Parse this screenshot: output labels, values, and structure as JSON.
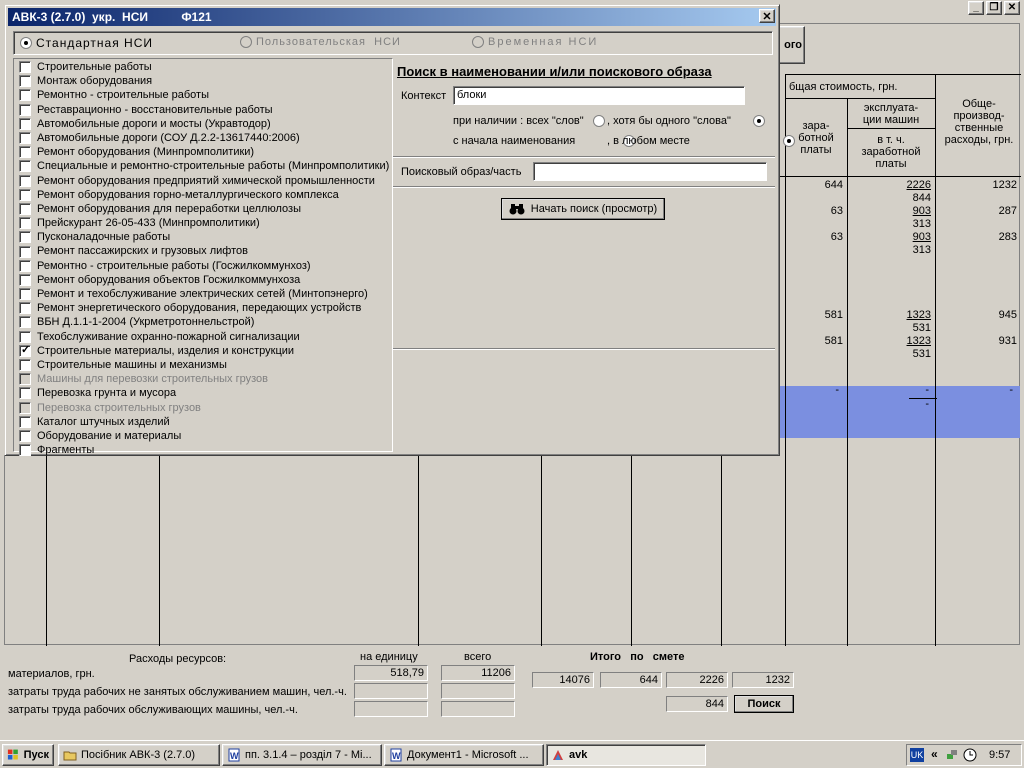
{
  "window_controls": [
    "_",
    "❐",
    "✕"
  ],
  "partial_button": "ого",
  "table": {
    "header_total": "бщая стоимость, грн.",
    "col_wage": "зара-\nботной\nплаты",
    "col_machine": "эксплуата-\nции машин",
    "col_machine_sub": "в т. ч.\nзаработной\nплаты",
    "col_overhead": "Обще-\nпроизвод-\nственные\nрасходы, грн.",
    "rows": [
      {
        "wage": "644",
        "machine": "2226",
        "machine_sub": "844",
        "overhead": "1232"
      },
      {
        "wage": "63",
        "machine": "903",
        "machine_sub": "313",
        "overhead": "287"
      },
      {
        "wage": "63",
        "machine": "903",
        "machine_sub": "313",
        "overhead": "283"
      },
      {
        "wage": "581",
        "machine": "1323",
        "machine_sub": "531",
        "overhead": "945"
      },
      {
        "wage": "581",
        "machine": "1323",
        "machine_sub": "531",
        "overhead": "931"
      }
    ],
    "selected_row": {
      "wage": "-",
      "machine": "-",
      "machine_sub": "-",
      "overhead": "-"
    }
  },
  "dialog": {
    "title": "АВК-3 (2.7.0)  укр.  НСИ          Ф121",
    "close": "✕",
    "nsi_options": [
      "Стандартная НСИ",
      "Пользовательская  НСИ",
      "Временная НСИ"
    ],
    "list": [
      {
        "label": "Строительные работы",
        "checked": false,
        "disabled": false
      },
      {
        "label": "Монтаж оборудования",
        "checked": false,
        "disabled": false
      },
      {
        "label": "Ремонтно - строительные работы",
        "checked": false,
        "disabled": false
      },
      {
        "label": "Реставрационно - восстановительные работы",
        "checked": false,
        "disabled": false
      },
      {
        "label": "Автомобильные дороги и мосты (Укравтодор)",
        "checked": false,
        "disabled": false
      },
      {
        "label": "Автомобильные дороги (СОУ Д.2.2-13617440:2006)",
        "checked": false,
        "disabled": false
      },
      {
        "label": "Ремонт оборудования (Минпромполитики)",
        "checked": false,
        "disabled": false
      },
      {
        "label": "Специальные и ремонтно-строительные работы (Минпромполитики)",
        "checked": false,
        "disabled": false
      },
      {
        "label": "Ремонт оборудования предприятий химической промышленности",
        "checked": false,
        "disabled": false
      },
      {
        "label": "Ремонт оборудования  горно-металлургического комплекса",
        "checked": false,
        "disabled": false
      },
      {
        "label": "Ремонт оборудования для переработки целлюлозы",
        "checked": false,
        "disabled": false
      },
      {
        "label": "Прейскурант 26-05-433 (Минпромполитики)",
        "checked": false,
        "disabled": false
      },
      {
        "label": "Пусконаладочные работы",
        "checked": false,
        "disabled": false
      },
      {
        "label": "Ремонт пассажирских и грузовых лифтов",
        "checked": false,
        "disabled": false
      },
      {
        "label": "Ремонтно - строительные работы (Госжилкоммунхоз)",
        "checked": false,
        "disabled": false
      },
      {
        "label": "Ремонт оборудования объектов Госжилкоммунхоза",
        "checked": false,
        "disabled": false
      },
      {
        "label": "Ремонт и техобслуживание электрических сетей (Минтопэнерго)",
        "checked": false,
        "disabled": false
      },
      {
        "label": "Ремонт энергетического оборудования, передающих устройств",
        "checked": false,
        "disabled": false
      },
      {
        "label": "ВБН Д.1.1-1-2004 (Укрметротоннельстрой)",
        "checked": false,
        "disabled": false
      },
      {
        "label": "Техобслуживание охранно-пожарной сигнализации",
        "checked": false,
        "disabled": false
      },
      {
        "label": "Строительные материалы, изделия и конструкции",
        "checked": true,
        "disabled": false
      },
      {
        "label": "Строительные машины и механизмы",
        "checked": false,
        "disabled": false
      },
      {
        "label": "Машины для перевозки строительных грузов",
        "checked": false,
        "disabled": true
      },
      {
        "label": "Перевозка грунта и мусора",
        "checked": false,
        "disabled": false
      },
      {
        "label": "Перевозка строительных грузов",
        "checked": false,
        "disabled": true
      },
      {
        "label": "Каталог штучных изделий",
        "checked": false,
        "disabled": false
      },
      {
        "label": "Оборудование и материалы",
        "checked": false,
        "disabled": false
      },
      {
        "label": "Фрагменты",
        "checked": false,
        "disabled": false
      }
    ],
    "search_title": "Поиск в наименовании и/или поискового образа",
    "context_label": "Контекст",
    "context_value": "блоки",
    "presence_label": "при наличии : всех \"слов\"",
    "presence_alt": ", хотя бы одного \"слова\"",
    "start_label": "с начала наименования",
    "start_alt": ", в любом месте",
    "pattern_label": "Поисковый образ/часть",
    "pattern_value": "",
    "search_button": "Начать поиск (просмотр)"
  },
  "bottom": {
    "resources_title": "Расходы ресурсов:",
    "per_unit": "на единицу",
    "total": "всего",
    "summary_title": "Итого   по   смете",
    "materials_label": "материалов, грн.",
    "materials_unit": "518,79",
    "materials_total": "11206",
    "labor1_label": "затраты труда рабочих не занятых обслуживанием машин, чел.-ч.",
    "labor2_label": "затраты труда рабочих обслуживающих машины, чел.-ч.",
    "sum1": "14076",
    "sum2": "644",
    "sum3": "2226",
    "sum4": "1232",
    "sum5": "844",
    "search_button": "Поиск"
  },
  "taskbar": {
    "start": "Пуск",
    "tasks": [
      "Посібник АВК-3 (2.7.0)",
      "пп. 3.1.4 – розділ 7 - Mi...",
      "Документ1 - Microsoft ...",
      "avk"
    ],
    "lang": "UK",
    "time": "9:57"
  },
  "colors": {
    "title_start": "#0a246a",
    "title_end": "#a6caf0",
    "selection": "#7b8fe0"
  }
}
